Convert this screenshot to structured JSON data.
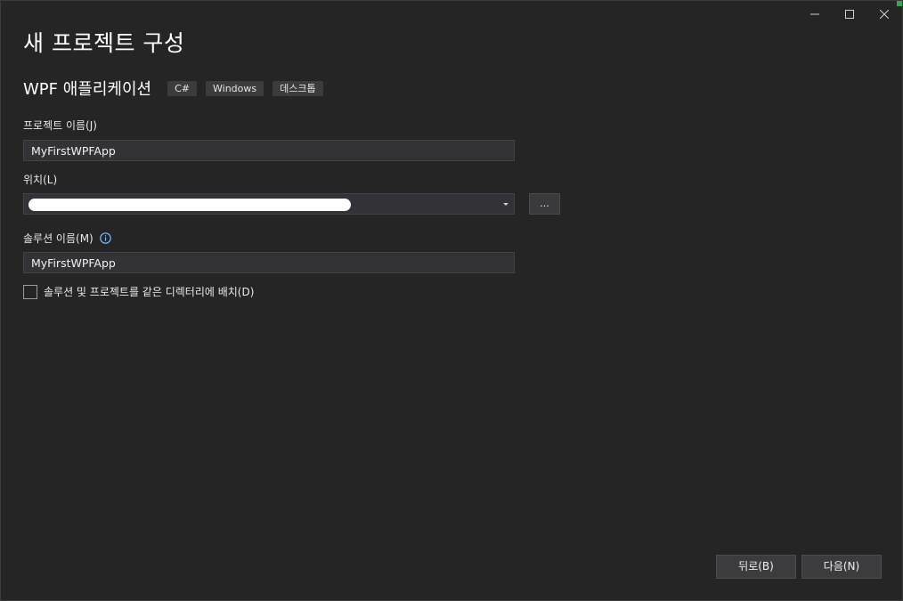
{
  "window": {
    "controls": {
      "minimize_icon": "minimize-icon",
      "maximize_icon": "maximize-icon",
      "close_icon": "close-icon"
    },
    "accent_color": "#2fa84f"
  },
  "dialog": {
    "title": "새 프로젝트 구성"
  },
  "template": {
    "name": "WPF 애플리케이션",
    "tags": [
      "C#",
      "Windows",
      "데스크톱"
    ]
  },
  "project_name": {
    "label": "프로젝트 이름(J)",
    "value": "MyFirstWPFApp"
  },
  "location": {
    "label": "위치(L)",
    "browse_label": "..."
  },
  "solution_name": {
    "label": "솔루션 이름(M)",
    "value": "MyFirstWPFApp",
    "info_icon": "info-icon",
    "info_color": "#75beff"
  },
  "same_directory": {
    "label": "솔루션 및 프로젝트를 같은 디렉터리에 배치(D)",
    "checked": false
  },
  "footer": {
    "back_label": "뒤로(B)",
    "next_label": "다음(N)"
  }
}
